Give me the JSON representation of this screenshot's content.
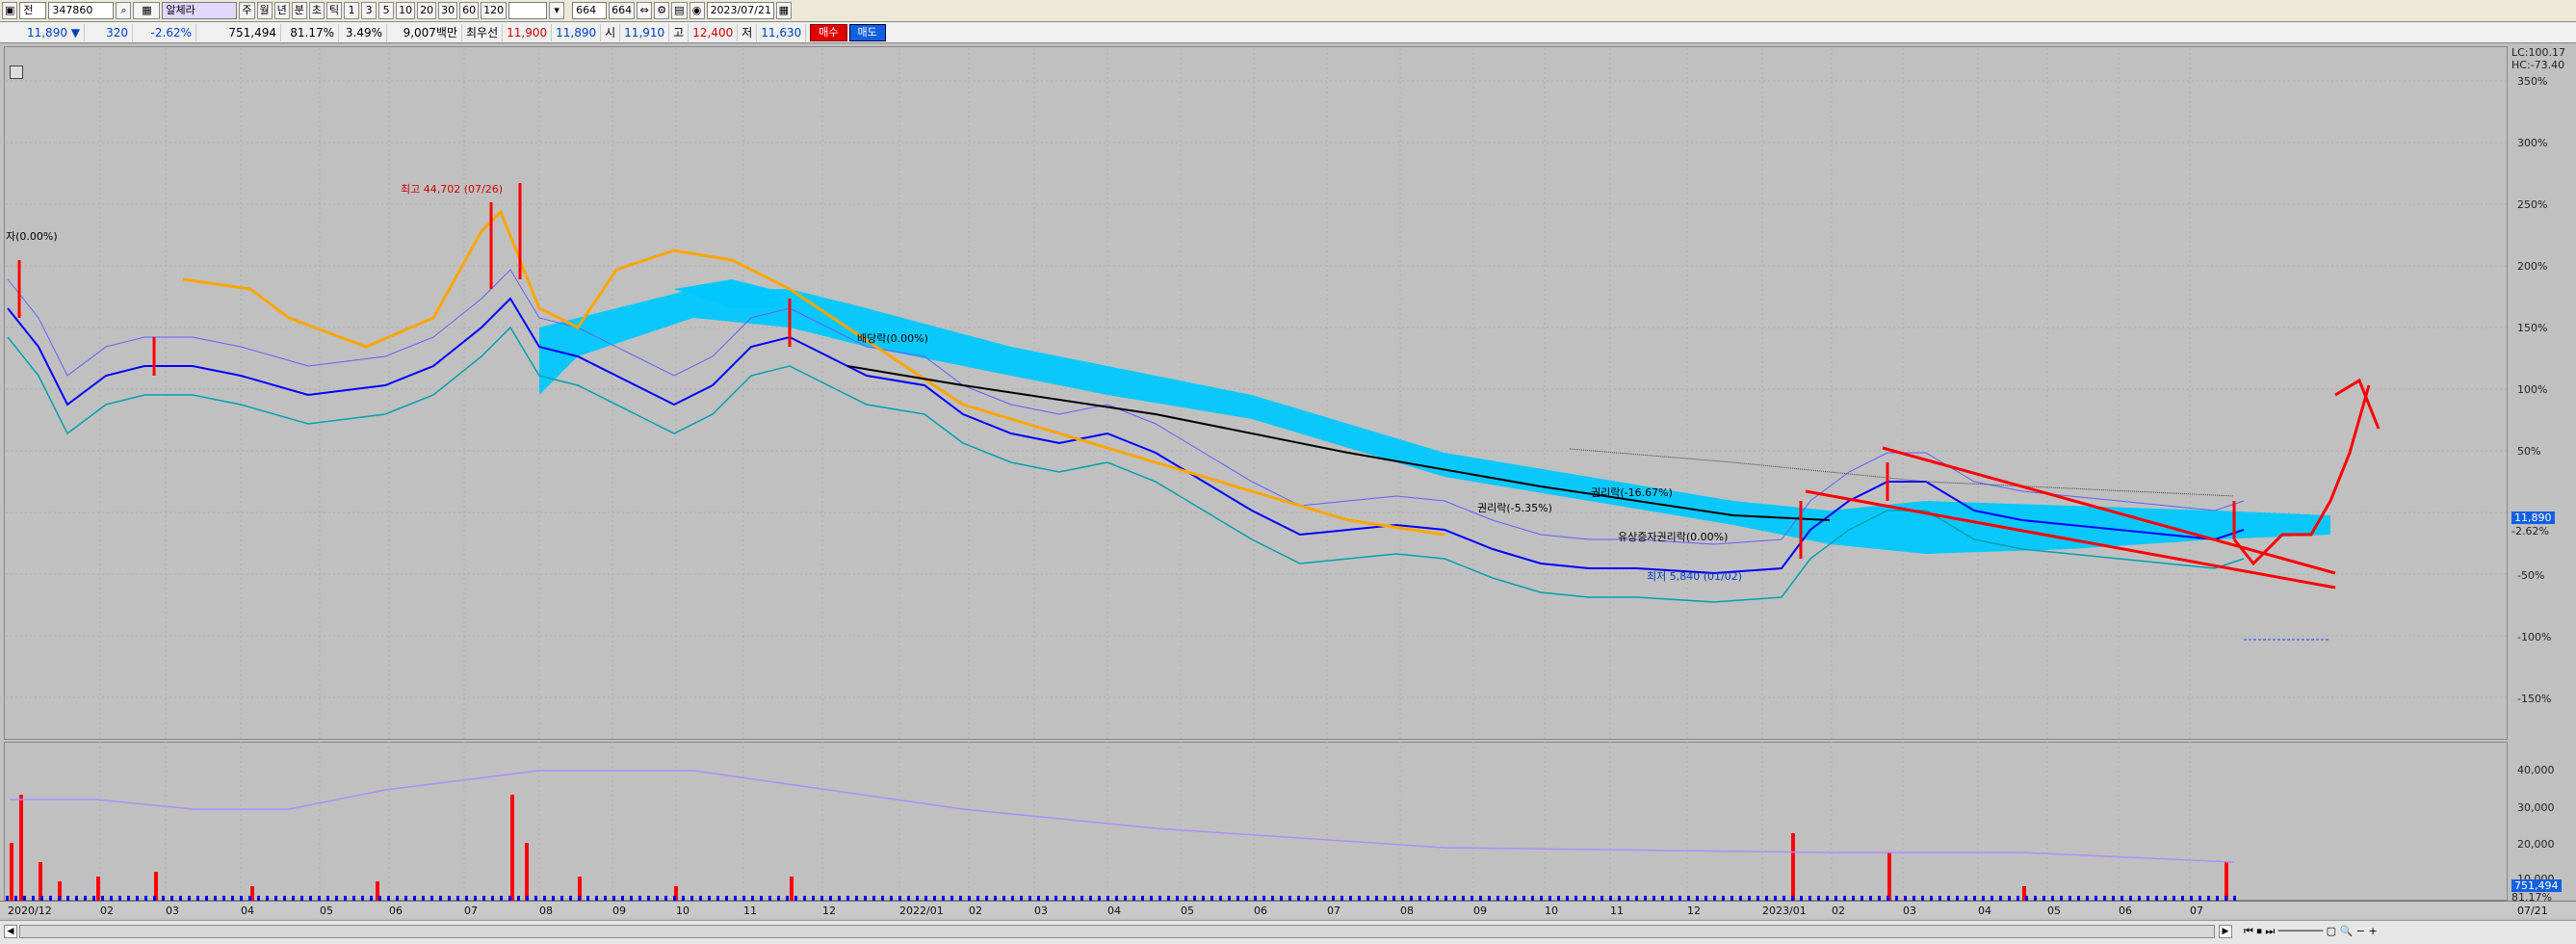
{
  "toolbar": {
    "period_combo": "전",
    "code": "347860",
    "stock_name": "알체라",
    "periods": [
      "주",
      "월",
      "년",
      "분",
      "초",
      "틱"
    ],
    "minutes": [
      "1",
      "3",
      "5",
      "10",
      "20",
      "30",
      "60",
      "120"
    ],
    "count": "664",
    "count_total": "664",
    "date": "2023/07/21"
  },
  "quote": {
    "price": "11,890 ▼",
    "change": "320",
    "change_pct": "-2.62%",
    "volume": "751,494",
    "volume_ratio": "81.17%",
    "turnover_pct": "3.49%",
    "amount": "9,007백만",
    "best_ask_label": "최우선",
    "best_ask_1": "11,900",
    "best_ask_2": "11,890",
    "open_label": "시",
    "open": "11,910",
    "high_label": "고",
    "high": "12,400",
    "low_label": "저",
    "low": "11,630",
    "buy_label": "매수",
    "sell_label": "매도"
  },
  "annotations": {
    "high": "최고 44,702 (07/26)",
    "low": "최저 5,840 (01/02)",
    "start": "자(0.00%)",
    "dividend": "배당락(0.00%)",
    "rights1": "권리락(-5.35%)",
    "rights2": "권리락(-16.67%)",
    "rights3": "유상증자권리락(0.00%)"
  },
  "right_axis": {
    "lc": "LC:100.17",
    "hc": "HC:-73.40",
    "pct_ticks": [
      "350%",
      "300%",
      "250%",
      "200%",
      "150%",
      "100%",
      "50%",
      "-50%",
      "-100%",
      "-150%"
    ],
    "current_price": "11,890",
    "current_pct": "-2.62%",
    "vol_ticks": [
      "40,000",
      "30,000",
      "20,000",
      "10,000"
    ],
    "current_vol": "751,494",
    "current_vol_pct": "81.17%"
  },
  "x_axis": {
    "labels": [
      "2020/12",
      "02",
      "03",
      "04",
      "05",
      "06",
      "07",
      "08",
      "09",
      "10",
      "11",
      "12",
      "2022/01",
      "02",
      "03",
      "04",
      "05",
      "06",
      "07",
      "08",
      "09",
      "10",
      "11",
      "12",
      "2023/01",
      "02",
      "03",
      "04",
      "05",
      "06",
      "07",
      "07/21"
    ]
  },
  "colors": {
    "candle_up": "#ff0000",
    "candle_down": "#0000ff",
    "ichimoku_cloud": "#00c8ff",
    "background": "#c0c0c0",
    "envelope": "#ffa500",
    "bollinger": "#00a0b0",
    "long_ma": "#000000"
  },
  "icons": [
    "search-icon",
    "chart-icon",
    "save-icon",
    "settings-icon",
    "calendar-icon",
    "scroll-left-icon",
    "scroll-right-icon"
  ]
}
